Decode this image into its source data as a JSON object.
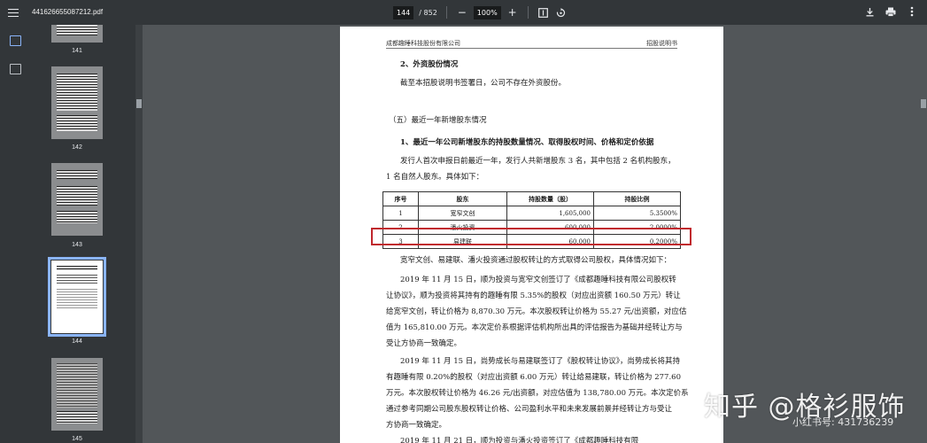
{
  "toolbar": {
    "file_name": "441626655087212.pdf",
    "current_page": "144",
    "page_separator": "/ 852",
    "zoom_minus": "−",
    "zoom_value": "100%",
    "zoom_plus": "+",
    "icons": [
      "menu-icon",
      "fit-page-icon",
      "rotate-icon",
      "download-icon",
      "print-icon",
      "more-icon"
    ]
  },
  "thumbnails": [
    {
      "number": "141"
    },
    {
      "number": "142"
    },
    {
      "number": "143"
    },
    {
      "number": "144",
      "selected": true
    },
    {
      "number": "145"
    }
  ],
  "page": {
    "header_left": "成都趣睡科技股份有限公司",
    "header_right": "招股说明书",
    "section1_title": "2、外资股份情况",
    "section1_text": "截至本招股说明书签署日，公司不存在外资股份。",
    "section2_title": "（五）最近一年新增股东情况",
    "section3_title": "1、最近一年公司新增股东的持股数量情况、取得股权时间、价格和定价依据",
    "intro_line1": "发行人首次申报日前最近一年，发行人共新增股东 3 名，其中包括 2 名机构股东，",
    "intro_line2": "1 名自然人股东。具体如下：",
    "table": {
      "headers": [
        "序号",
        "股东",
        "持股数量（股）",
        "持股比例"
      ],
      "rows": [
        [
          "1",
          "宽窄文创",
          "1,605,000",
          "5.3500%"
        ],
        [
          "2",
          "潘火投资",
          "600,000",
          "2.0000%"
        ],
        [
          "3",
          "易建联",
          "60,000",
          "0.2000%"
        ]
      ]
    },
    "after_table": "宽窄文创、易建联、潘火投资通过股权转让的方式取得公司股权，具体情况如下：",
    "para1": [
      "2019 年 11 月 15 日，顺为投资与宽窄文创签订了《成都趣睡科技有限公司股权转",
      "让协议》，顺为投资将其持有的趣睡有限 5.35%的股权（对应出资额 160.50 万元）转让",
      "给宽窄文创，转让价格为 8,870.30 万元。本次股权转让价格为 55.27 元/出资额，对应估",
      "值为 165,810.00 万元。本次定价系根据评估机构所出具的评估报告为基础并经转让方与",
      "受让方协商一致确定。"
    ],
    "para2": [
      "2019 年 11 月 15 日，尚势成长与易建联签订了《股权转让协议》，尚势成长将其持",
      "有趣睡有限 0.20%的股权（对应出资额 6.00 万元）转让给易建联，转让价格为 277.60",
      "万元。本次股权转让价格为 46.26 元/出资额，对应估值为 138,780.00 万元。本次定价系",
      "通过参考同期公司股东股权转让价格、公司盈利水平和未来发展前景并经转让方与受让",
      "方协商一致确定。"
    ],
    "para3_line1": "2019 年 11 月 21 日，顺为投资与潘火投资签订了《成都趣睡科技有限"
  },
  "watermark": {
    "main": "知乎 @格衫服饰",
    "sub": "小红书号: 431736239"
  }
}
